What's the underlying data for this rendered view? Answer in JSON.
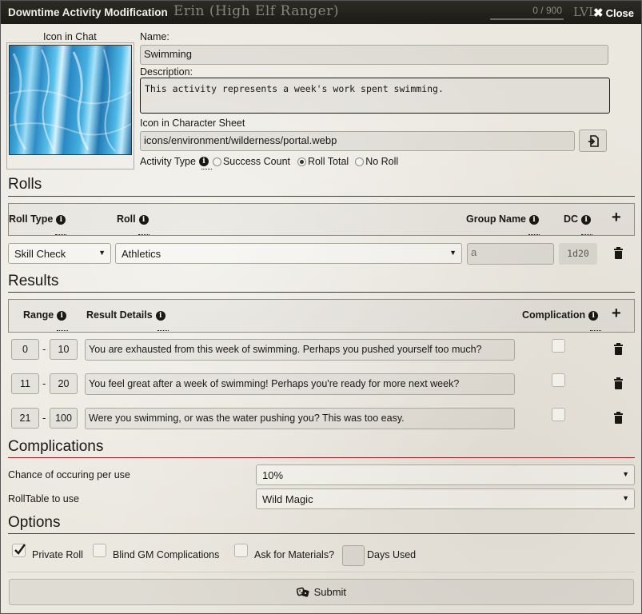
{
  "window": {
    "title": "Downtime Activity Modification",
    "background_name": "Erin (High Elf Ranger)",
    "background_xp": "0 / 900",
    "background_lvl": "LVL",
    "close_label": "Close"
  },
  "chat_icon": {
    "label": "Icon in Chat"
  },
  "name": {
    "label": "Name:",
    "value": "Swimming"
  },
  "description": {
    "label": "Description:",
    "value": "This activity represents a week's work spent swimming."
  },
  "sheet_icon": {
    "label": "Icon in Character Sheet",
    "value": "icons/environment/wilderness/portal.webp"
  },
  "activity_type": {
    "label": "Activity Type",
    "options": [
      "Success Count",
      "Roll Total",
      "No Roll"
    ],
    "selected": "Roll Total"
  },
  "rolls": {
    "heading": "Rolls",
    "headers": {
      "roll_type": "Roll Type",
      "roll": "Roll",
      "group_name": "Group Name",
      "dc": "DC"
    },
    "row": {
      "roll_type": "Skill Check",
      "roll": "Athletics",
      "group_name": "a",
      "dc": "1d20"
    }
  },
  "results": {
    "heading": "Results",
    "headers": {
      "range": "Range",
      "details": "Result Details",
      "complication": "Complication"
    },
    "rows": [
      {
        "min": "0",
        "max": "10",
        "details": "You are exhausted from this week of swimming. Perhaps you pushed yourself too much?",
        "complication": false
      },
      {
        "min": "11",
        "max": "20",
        "details": "You feel great after a week of swimming! Perhaps you're ready for more next week?",
        "complication": false
      },
      {
        "min": "21",
        "max": "100",
        "details": "Were you swimming, or was the water pushing you? This was too easy.",
        "complication": false
      }
    ],
    "range_separator": "-"
  },
  "complications": {
    "heading": "Complications",
    "chance_label": "Chance of occuring per use",
    "chance_value": "10%",
    "table_label": "RollTable to use",
    "table_value": "Wild Magic"
  },
  "options": {
    "heading": "Options",
    "private_roll": {
      "label": "Private Roll",
      "checked": true
    },
    "blind_gm": {
      "label": "Blind GM Complications",
      "checked": false
    },
    "ask_materials": {
      "label": "Ask for Materials?",
      "checked": false
    },
    "days_used": {
      "label": "Days Used",
      "value": ""
    }
  },
  "submit": {
    "label": "Submit"
  },
  "colors": {
    "accent_rule": "#8b1f1f",
    "titlebar": "#23221d"
  },
  "icons": [
    "close-icon",
    "file-picker-icon",
    "info-icon",
    "plus-icon",
    "trash-icon",
    "dice-icon"
  ]
}
